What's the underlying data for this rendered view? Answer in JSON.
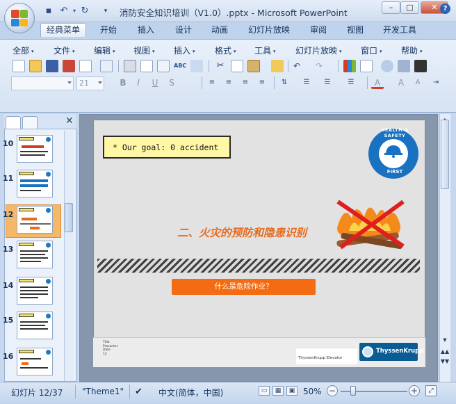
{
  "window": {
    "title": "消防安全知识培训（V1.0）.pptx - Microsoft PowerPoint",
    "minimize_glyph": "–",
    "maximize_glyph": "□",
    "close_glyph": "✕"
  },
  "quick_access": {
    "save_icon": "💾",
    "undo_icon": "↶",
    "undo_arrow": "▾",
    "redo_icon": "↻",
    "customize_icon": "▾"
  },
  "ribbon_tabs": [
    {
      "label": "经典菜单",
      "active": true
    },
    {
      "label": "开始"
    },
    {
      "label": "插入"
    },
    {
      "label": "设计"
    },
    {
      "label": "动画"
    },
    {
      "label": "幻灯片放映"
    },
    {
      "label": "审阅"
    },
    {
      "label": "视图"
    },
    {
      "label": "开发工具"
    }
  ],
  "help_glyph": "?",
  "classic_menu": [
    {
      "label": "全部"
    },
    {
      "label": "文件"
    },
    {
      "label": "编辑"
    },
    {
      "label": "视图"
    },
    {
      "label": "插入"
    },
    {
      "label": "格式"
    },
    {
      "label": "工具"
    },
    {
      "label": "幻灯片放映"
    },
    {
      "label": "窗口"
    },
    {
      "label": "帮助"
    }
  ],
  "menu_arrow": "▾",
  "toolbar": {
    "font_size_value": "21",
    "bold": "B",
    "italic": "I",
    "underline": "U",
    "strike": "S",
    "shadow": "A",
    "font_color": "A"
  },
  "left_pane": {
    "close_glyph": "✕",
    "thumbnails": [
      {
        "number": "10"
      },
      {
        "number": "11"
      },
      {
        "number": "12",
        "selected": true
      },
      {
        "number": "13"
      },
      {
        "number": "14"
      },
      {
        "number": "15"
      },
      {
        "number": "16"
      }
    ]
  },
  "slide": {
    "goal_text": "* Our goal: 0 accident",
    "badge_top": "HEALTH & SAFETY",
    "badge_bottom": "FIRST",
    "section_title": "二、火灾的预防和隐患识别",
    "risk_button": "什么是危险作业？",
    "footer_title": "Title",
    "footer_presenter": "Presenter",
    "footer_date": "Date",
    "footer_page": "12",
    "footer_company": "ThyssenKrupp Elevator",
    "logo_text": "ThyssenKrupp"
  },
  "scrollbar": {
    "up_arrow": "▲",
    "down_arrow": "▼",
    "prev_slide": "▲▲",
    "next_slide": "▼▼"
  },
  "status": {
    "slide_info": "幻灯片 12/37",
    "theme": "\"Theme1\"",
    "language": "中文(简体，中国)",
    "zoom": "50%",
    "zoom_minus": "−",
    "zoom_plus": "+",
    "zoom_level_percent": 50
  },
  "colors": {
    "accent_orange": "#f36b12",
    "title_orange": "#e96a1b",
    "goal_yellow": "#fff7a6",
    "safety_blue": "#1871c1",
    "thyssen_blue": "#0a5d94"
  },
  "icons": {
    "spell": "ABC",
    "format_painter": "🖌"
  }
}
